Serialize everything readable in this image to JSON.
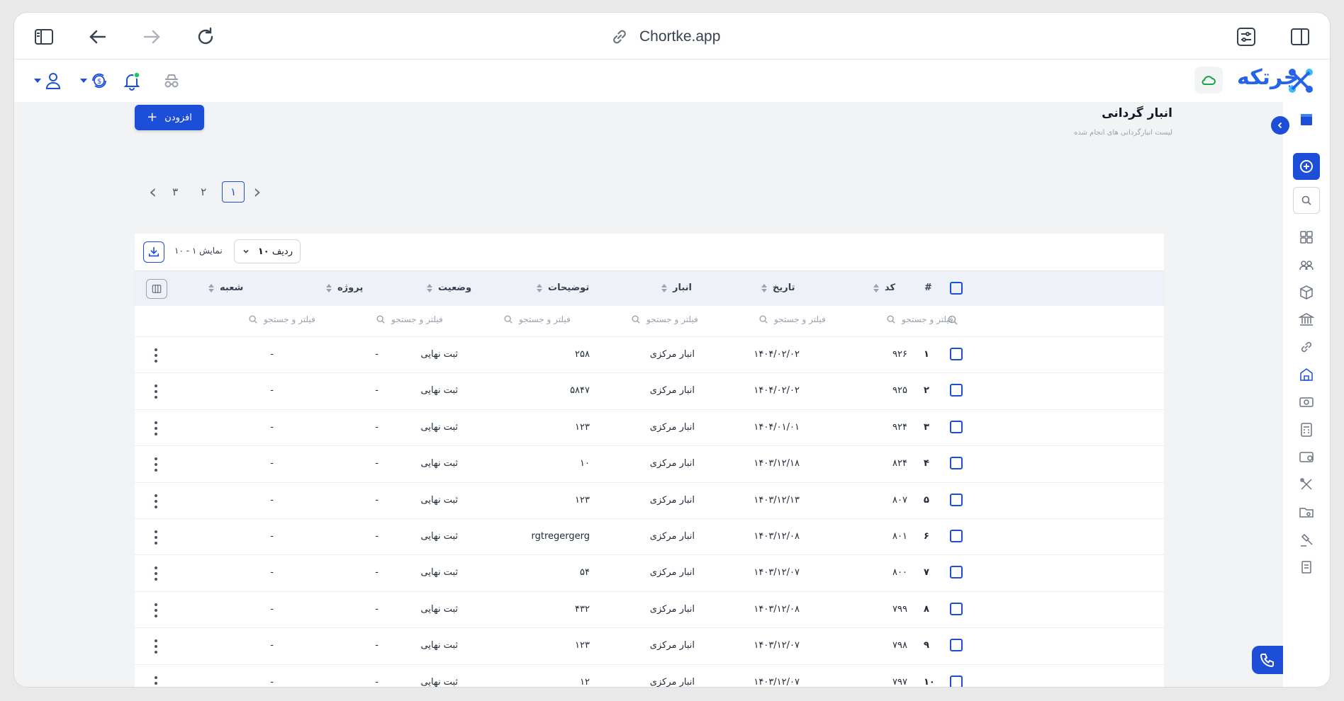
{
  "browser": {
    "url": "Chortke.app"
  },
  "header": {
    "logo_text": "چرتکه"
  },
  "page": {
    "title": "انبار گردانی",
    "subtitle": "لیست انبارگردانی های انجام شده",
    "add_label": "افزودن"
  },
  "pagination": {
    "pages": [
      "۳",
      "۲",
      "۱"
    ],
    "active": "۱"
  },
  "toolbar": {
    "showing": "نمایش ۱ - ۱۰",
    "rows_label": "ردیف",
    "rows_value": "۱۰"
  },
  "table": {
    "headers": {
      "index": "#",
      "code": "کد",
      "date": "تاریخ",
      "warehouse": "انبار",
      "description": "توضیحات",
      "status": "وضعیت",
      "project": "پروژه",
      "branch": "شعبه"
    },
    "filter_placeholder": "فیلتر و جستجو",
    "rows": [
      {
        "idx": "۱",
        "code": "۹۲۶",
        "date": "۱۴۰۴/۰۲/۰۲",
        "warehouse": "انبار مرکزی",
        "description": "۲۵۸",
        "status": "ثبت نهایی",
        "project": "-",
        "branch": "-"
      },
      {
        "idx": "۲",
        "code": "۹۲۵",
        "date": "۱۴۰۴/۰۲/۰۲",
        "warehouse": "انبار مرکزی",
        "description": "۵۸۴۷",
        "status": "ثبت نهایی",
        "project": "-",
        "branch": "-"
      },
      {
        "idx": "۳",
        "code": "۹۲۴",
        "date": "۱۴۰۴/۰۱/۰۱",
        "warehouse": "انبار مرکزی",
        "description": "۱۲۳",
        "status": "ثبت نهایی",
        "project": "-",
        "branch": "-"
      },
      {
        "idx": "۴",
        "code": "۸۲۴",
        "date": "۱۴۰۳/۱۲/۱۸",
        "warehouse": "انبار مرکزی",
        "description": "۱۰",
        "status": "ثبت نهایی",
        "project": "-",
        "branch": "-"
      },
      {
        "idx": "۵",
        "code": "۸۰۷",
        "date": "۱۴۰۳/۱۲/۱۳",
        "warehouse": "انبار مرکزی",
        "description": "۱۲۳",
        "status": "ثبت نهایی",
        "project": "-",
        "branch": "-"
      },
      {
        "idx": "۶",
        "code": "۸۰۱",
        "date": "۱۴۰۳/۱۲/۰۸",
        "warehouse": "انبار مرکزی",
        "description": "rgtregergerg",
        "status": "ثبت نهایی",
        "project": "-",
        "branch": "-"
      },
      {
        "idx": "۷",
        "code": "۸۰۰",
        "date": "۱۴۰۳/۱۲/۰۷",
        "warehouse": "انبار مرکزی",
        "description": "۵۴",
        "status": "ثبت نهایی",
        "project": "-",
        "branch": "-"
      },
      {
        "idx": "۸",
        "code": "۷۹۹",
        "date": "۱۴۰۳/۱۲/۰۸",
        "warehouse": "انبار مرکزی",
        "description": "۴۳۲",
        "status": "ثبت نهایی",
        "project": "-",
        "branch": "-"
      },
      {
        "idx": "۹",
        "code": "۷۹۸",
        "date": "۱۴۰۳/۱۲/۰۷",
        "warehouse": "انبار مرکزی",
        "description": "۱۲۳",
        "status": "ثبت نهایی",
        "project": "-",
        "branch": "-"
      },
      {
        "idx": "۱۰",
        "code": "۷۹۷",
        "date": "۱۴۰۳/۱۲/۰۷",
        "warehouse": "انبار مرکزی",
        "description": "۱۲",
        "status": "ثبت نهایی",
        "project": "-",
        "branch": "-"
      }
    ]
  },
  "sidebar": {
    "icons": [
      "store-icon",
      "dashboard-icon",
      "users-icon",
      "box-icon",
      "bank-icon",
      "link-icon",
      "warehouse-icon",
      "cash-icon",
      "calculator-icon",
      "wallet-icon",
      "tools-icon",
      "folder-icon",
      "auction-icon",
      "documents-icon"
    ]
  },
  "colors": {
    "accent": "#1d4ed8",
    "header_row": "#eef2f8",
    "cloud": "#16a34a",
    "notification_dot": "#22c55e"
  }
}
